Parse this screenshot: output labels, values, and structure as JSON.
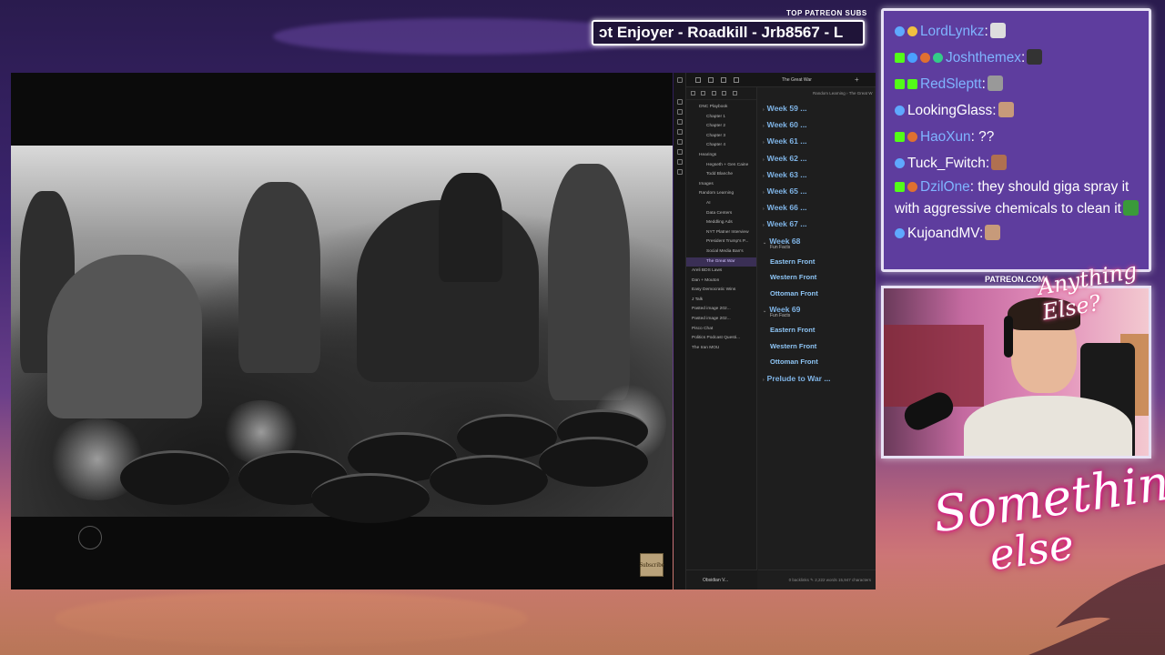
{
  "patreon": {
    "label": "TOP PATREON SUBS",
    "ticker_text": "ɔt Enjoyer - Roadkill - Jrb8567 - L"
  },
  "chat": {
    "messages": [
      {
        "user": "LordLynkz",
        "text": ":",
        "badges": [
          "twitch-prime",
          "subscriber"
        ],
        "user_color": "#7fb4ff",
        "emote": "dog-emote"
      },
      {
        "user": "Joshthemex",
        "text": ":",
        "badges": [
          "kick",
          "vip",
          "gift",
          "turbo"
        ],
        "user_color": "#7fb4ff",
        "emote": "cat-emote"
      },
      {
        "user": "RedSleptt",
        "text": ":",
        "badges": [
          "kick",
          "mod"
        ],
        "user_color": "#7fb4ff",
        "emote": "gray-emote"
      },
      {
        "user": "LookingGlass",
        "text": ":",
        "badges": [
          "twitch-prime"
        ],
        "user_color": "#ffffff",
        "emote": "face-emote"
      },
      {
        "user": "HaoXun",
        "text": ": ??",
        "badges": [
          "kick",
          "gift"
        ],
        "user_color": "#7fb4ff",
        "emote": ""
      },
      {
        "user": "Tuck_Fwitch",
        "text": ":",
        "badges": [
          "twitch-prime"
        ],
        "user_color": "#ffffff",
        "emote": "wave-emote"
      },
      {
        "user": "DzilOne",
        "text": ": they should giga spray it with aggressive chemicals to clean it",
        "badges": [
          "kick",
          "gift"
        ],
        "user_color": "#7fb4ff",
        "emote": "pepe-emote"
      },
      {
        "user": "KujoandMV",
        "text": ":",
        "badges": [
          "twitch-prime"
        ],
        "user_color": "#ffffff",
        "emote": "face-emote"
      }
    ]
  },
  "obsidian": {
    "tab_title": "The Great War",
    "breadcrumb": "Random Learning  ›  The Great W",
    "vault_name": "Obsidian V...",
    "status": "0 backlinks   ✎   2,222 words  15,947 characters",
    "tree": [
      {
        "label": "DNC Playbook",
        "level": 1,
        "selected": false
      },
      {
        "label": "Chapter 1",
        "level": 2,
        "selected": false
      },
      {
        "label": "Chapter 2",
        "level": 2,
        "selected": false
      },
      {
        "label": "Chapter 3",
        "level": 2,
        "selected": false
      },
      {
        "label": "Chapter 4",
        "level": 2,
        "selected": false
      },
      {
        "label": "Hearings",
        "level": 1,
        "selected": false
      },
      {
        "label": "Hegseth + Gen Caine",
        "level": 2,
        "selected": false
      },
      {
        "label": "Todd Blanche",
        "level": 2,
        "selected": false
      },
      {
        "label": "Images",
        "level": 1,
        "selected": false
      },
      {
        "label": "Random Learning",
        "level": 1,
        "selected": false
      },
      {
        "label": "AI",
        "level": 2,
        "selected": false
      },
      {
        "label": "Data Centers",
        "level": 2,
        "selected": false
      },
      {
        "label": "Meddling Ads",
        "level": 2,
        "selected": false
      },
      {
        "label": "NYT Platner Interview",
        "level": 2,
        "selected": false
      },
      {
        "label": "President Trump's P...",
        "level": 2,
        "selected": false
      },
      {
        "label": "Social Media Ban's",
        "level": 2,
        "selected": false
      },
      {
        "label": "The Great War",
        "level": 2,
        "selected": true
      },
      {
        "label": "Areli BDS Laws",
        "level": 0,
        "selected": false
      },
      {
        "label": "Dan + Mouton",
        "level": 0,
        "selected": false
      },
      {
        "label": "Easy Democratic Wins",
        "level": 0,
        "selected": false
      },
      {
        "label": "J Talk",
        "level": 0,
        "selected": false
      },
      {
        "label": "Pasted image 202...",
        "level": 0,
        "selected": false
      },
      {
        "label": "Pasted image 202...",
        "level": 0,
        "selected": false
      },
      {
        "label": "Pisco Chat",
        "level": 0,
        "selected": false
      },
      {
        "label": "Politics Podcast Questi...",
        "level": 0,
        "selected": false
      },
      {
        "label": "The Iran MOU",
        "level": 0,
        "selected": false
      }
    ],
    "outline": [
      {
        "kind": "week",
        "text": "Week 59 ..."
      },
      {
        "kind": "week",
        "text": "Week 60 ..."
      },
      {
        "kind": "week",
        "text": "Week 61 ..."
      },
      {
        "kind": "week",
        "text": "Week 62 ..."
      },
      {
        "kind": "week",
        "text": "Week 63 ..."
      },
      {
        "kind": "week",
        "text": "Week 65 ..."
      },
      {
        "kind": "week",
        "text": "Week 66 ..."
      },
      {
        "kind": "week",
        "text": "Week 67 ..."
      },
      {
        "kind": "week-open",
        "text": "Week 68",
        "note": "Fun Facts"
      },
      {
        "kind": "sub",
        "text": "Eastern Front"
      },
      {
        "kind": "sub",
        "text": "Western Front"
      },
      {
        "kind": "sub",
        "text": "Ottoman Front"
      },
      {
        "kind": "week-open",
        "text": "Week 69",
        "note": "Fun Facts"
      },
      {
        "kind": "sub",
        "text": "Eastern Front"
      },
      {
        "kind": "sub",
        "text": "Western Front"
      },
      {
        "kind": "sub",
        "text": "Ottoman Front"
      },
      {
        "kind": "week",
        "text": "Prelude to War ..."
      }
    ]
  },
  "webcam": {
    "patreon_url": "PATREON.COM/",
    "logo_text": "Anything Else?"
  },
  "brand": {
    "line1": "Something",
    "line2": "else"
  },
  "video": {
    "subscribe_label": "Subscribe",
    "description_colors": {
      "photo": "#8a8a8a",
      "frame": "#0b0b0b"
    }
  },
  "colors": {
    "chat_bg": "#5e3d9e",
    "accent_link": "#7fb4e6",
    "kick_badge": "#53fc18",
    "prime_badge": "#5fa8ff"
  }
}
